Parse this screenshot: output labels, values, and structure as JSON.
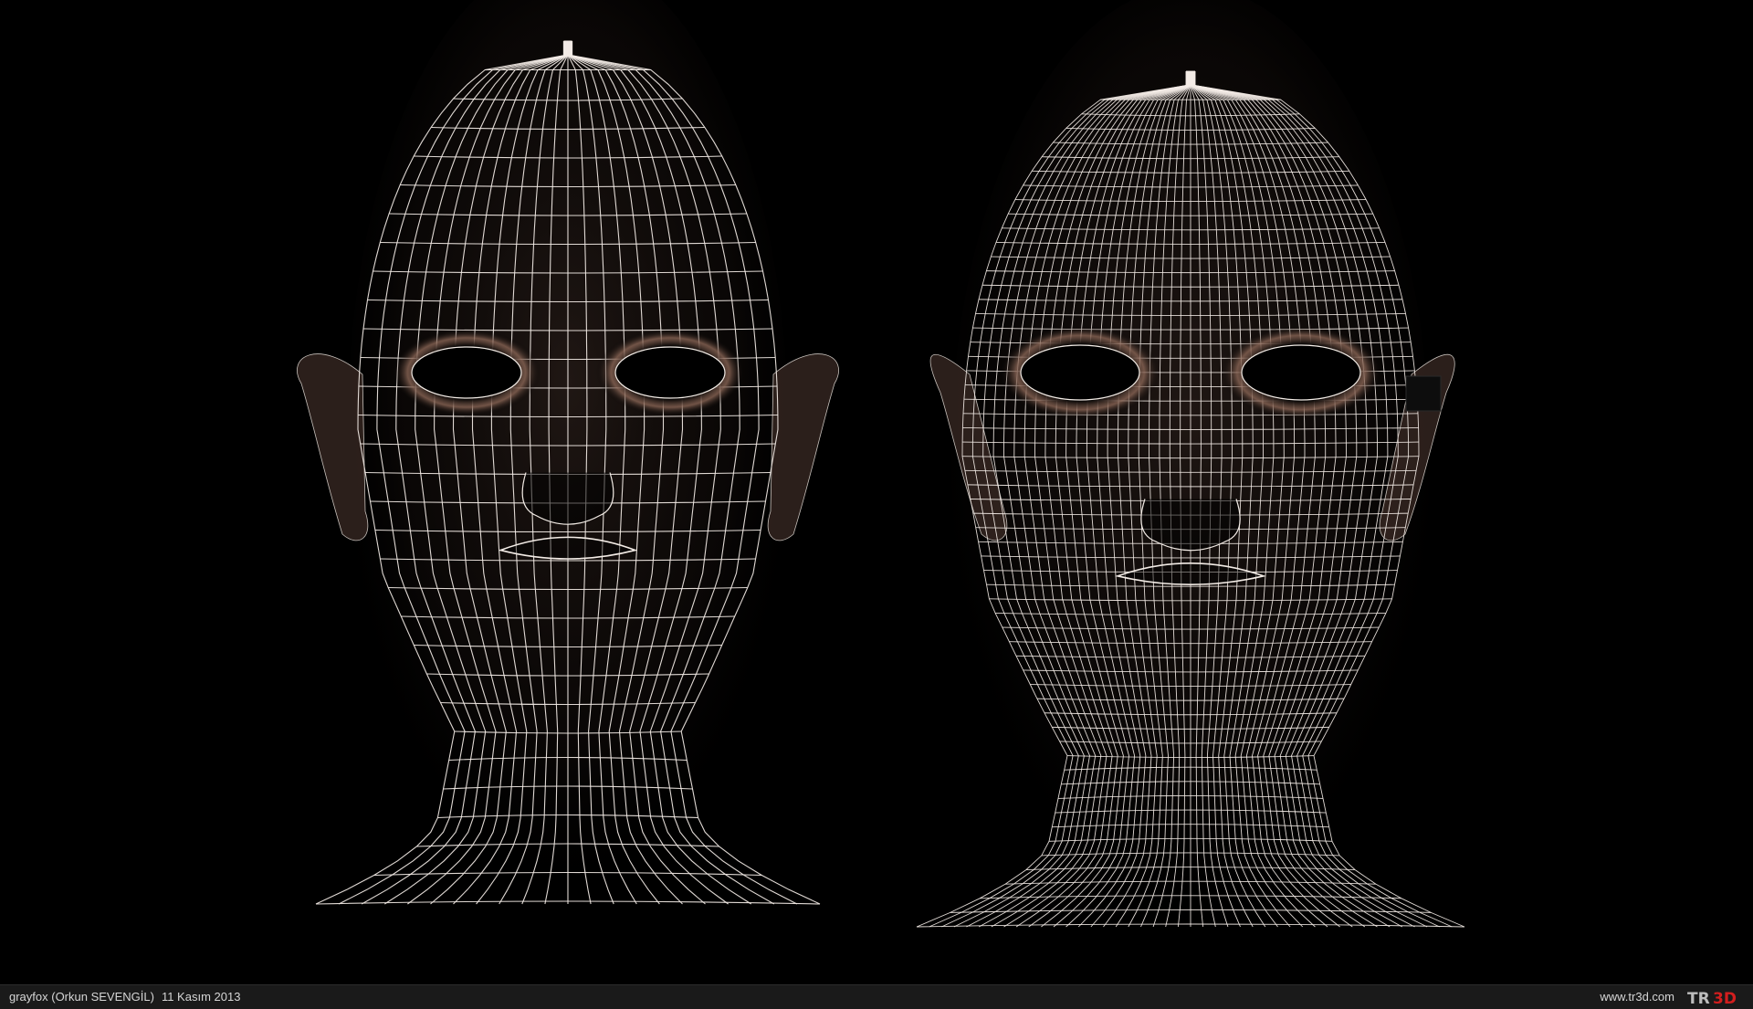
{
  "image": {
    "background": "#000000",
    "wire_color": "#f3ece6",
    "skin_shadow_color": "#7a5a4c",
    "subjects": [
      {
        "name": "low-poly-head-wireframe",
        "grid_columns": 22,
        "grid_rows": 30
      },
      {
        "name": "high-poly-head-wireframe",
        "grid_columns": 44,
        "grid_rows": 60
      }
    ]
  },
  "footer": {
    "author": "grayfox (Orkun SEVENGİL)",
    "date": "11 Kasım 2013",
    "website": "www.tr3d.com",
    "logo_text_a": "TR",
    "logo_text_b": "3D",
    "logo_accent": "#d21e1e"
  }
}
